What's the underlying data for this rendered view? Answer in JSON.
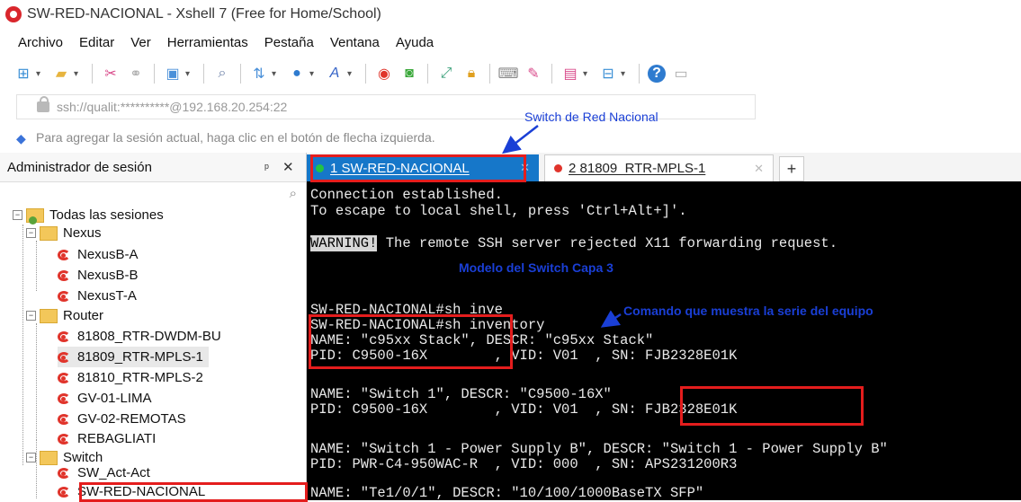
{
  "window": {
    "title": "SW-RED-NACIONAL - Xshell 7 (Free for Home/School)"
  },
  "menu": [
    "Archivo",
    "Editar",
    "Ver",
    "Herramientas",
    "Pestaña",
    "Ventana",
    "Ayuda"
  ],
  "address": {
    "value": "ssh://qualit:**********@192.168.20.254:22"
  },
  "hint": {
    "text": "Para agregar la sesión actual, haga clic en el botón de flecha izquierda."
  },
  "session_panel": {
    "title": "Administrador de sesión",
    "pin": "ᵖ",
    "close": "✕",
    "tree": {
      "root": "Todas las sesiones",
      "groups": [
        {
          "name": "Nexus",
          "items": [
            "NexusB-A",
            "NexusB-B",
            "NexusT-A"
          ]
        },
        {
          "name": "Router",
          "items": [
            "81808_RTR-DWDM-BU",
            "81809_RTR-MPLS-1",
            "81810_RTR-MPLS-2",
            "GV-01-LIMA",
            "GV-02-REMOTAS",
            "REBAGLIATI"
          ]
        },
        {
          "name": "Switch",
          "items": [
            "SW_Act-Act",
            "SW-RED-NACIONAL"
          ]
        }
      ]
    }
  },
  "tabs": [
    {
      "label": "1 SW-RED-NACIONAL",
      "status": "connected",
      "status_color": "#23c343"
    },
    {
      "label": "2 81809_RTR-MPLS-1",
      "status": "disconnected",
      "status_color": "#e0342b"
    }
  ],
  "terminal": {
    "lines": [
      "Connection established.",
      "To escape to local shell, press 'Ctrl+Alt+]'.",
      "",
      " The remote SSH server rejected X11 forwarding request.",
      "",
      "",
      "SW-RED-NACIONAL#sh inve",
      "SW-RED-NACIONAL#sh inventory",
      "NAME: \"c95xx Stack\", DESCR: \"c95xx Stack\"",
      "PID: C9500-16X        , VID: V01  , SN: FJB2328E01K",
      "",
      "NAME: \"Switch 1\", DESCR: \"C9500-16X\"",
      "PID: C9500-16X        , VID: V01  , SN: FJB2328E01K",
      "",
      "NAME: \"Switch 1 - Power Supply B\", DESCR: \"Switch 1 - Power Supply B\"",
      "PID: PWR-C4-950WAC-R  , VID: 000  , SN: APS231200R3",
      "",
      "NAME: \"Te1/0/1\", DESCR: \"10/100/1000BaseTX SFP\""
    ],
    "warning_tag": "WARNING!"
  },
  "annotations": {
    "switch_label": "Switch de Red Nacional",
    "model_label": "Modelo del Switch Capa 3",
    "command_label": "Comando que muestra la serie del equipo"
  },
  "colors": {
    "annot_blue": "#1a3fd6",
    "annot_red": "#e41d1d",
    "tab_active": "#1677c9"
  }
}
